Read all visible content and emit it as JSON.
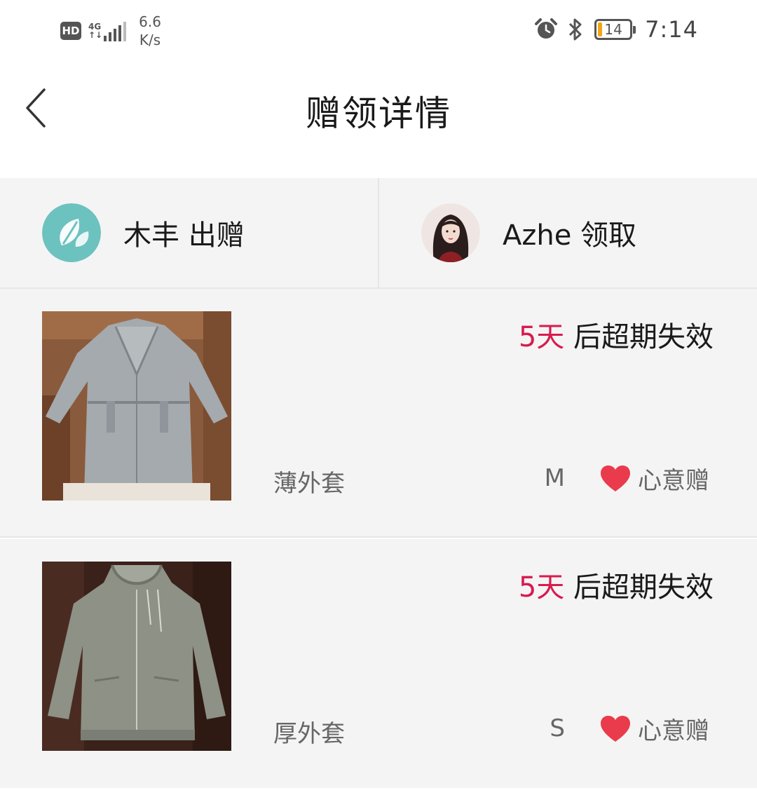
{
  "status_bar": {
    "hd": "HD",
    "network": "4G",
    "speed_value": "6.6",
    "speed_unit": "K/s",
    "battery_level": "14",
    "time": "7:14"
  },
  "header": {
    "title": "赠领详情"
  },
  "users": {
    "giver_label": "木丰 出赠",
    "receiver_label": "Azhe 领取"
  },
  "items": [
    {
      "expiry_days": "5天",
      "expiry_text": " 后超期失效",
      "name": "薄外套",
      "size": "M",
      "gift_type": "心意赠"
    },
    {
      "expiry_days": "5天",
      "expiry_text": " 后超期失效",
      "name": "厚外套",
      "size": "S",
      "gift_type": "心意赠"
    }
  ],
  "colors": {
    "accent": "#d81b50",
    "heart": "#ea3b4d",
    "background": "#f4f4f4"
  }
}
